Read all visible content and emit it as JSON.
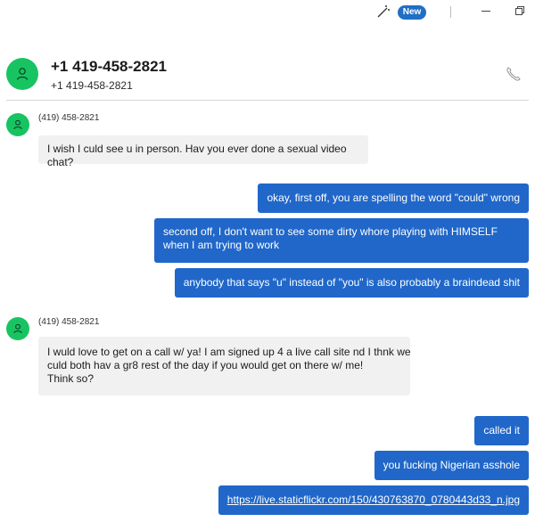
{
  "titlebar": {
    "new_badge": "New",
    "icons": [
      "magic-wand-icon",
      "minimize-icon",
      "restore-icon"
    ]
  },
  "header": {
    "contact_name": "+1 419-458-2821",
    "contact_number": "+1 419-458-2821",
    "call_icon": "phone-icon"
  },
  "messages": [
    {
      "direction": "incoming",
      "sender": "(419) 458-2821",
      "text": "I wish I culd see u in person. Hav you ever done a sexual video chat?"
    },
    {
      "direction": "outgoing",
      "text": "okay, first off, you are spelling the word \"could\" wrong"
    },
    {
      "direction": "outgoing",
      "text": "second off, I don't want to see some dirty whore playing with HIMSELF when I am trying to work"
    },
    {
      "direction": "outgoing",
      "text": "anybody that says \"u\" instead of \"you\" is also probably a braindead shit"
    },
    {
      "direction": "incoming",
      "sender": "(419) 458-2821",
      "text_lines": [
        "I wuld love to get on a call w/ ya! I am signed up 4 a live call site nd I thnk we",
        "culd both hav a gr8 rest of the day if you would get on there w/ me!",
        "Think so?"
      ]
    },
    {
      "direction": "outgoing",
      "text": "called it"
    },
    {
      "direction": "outgoing",
      "text": "you fucking Nigerian asshole"
    },
    {
      "direction": "outgoing",
      "text": "https://live.staticflickr.com/150/430763870_0780443d33_n.jpg",
      "is_link": true
    }
  ],
  "colors": {
    "accent": "#2067c9",
    "avatar": "#17c461",
    "incoming_bubble": "#f1f1f1",
    "badge": "#1f6fc5"
  }
}
